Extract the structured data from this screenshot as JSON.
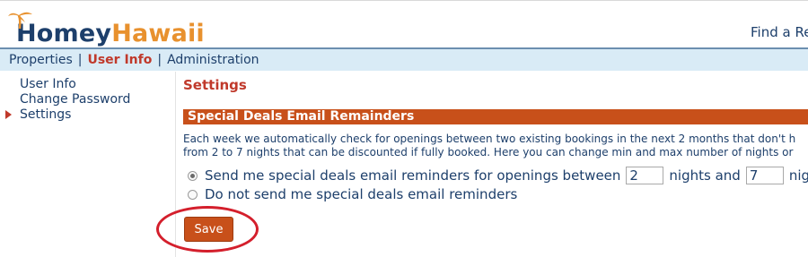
{
  "header": {
    "logo_homey": "Homey",
    "logo_hawaii": "Hawaii",
    "find_link": "Find a Re"
  },
  "nav": {
    "items": [
      {
        "label": "Properties"
      },
      {
        "label": "User Info"
      },
      {
        "label": "Administration"
      }
    ],
    "separator": "|"
  },
  "sidebar": {
    "items": [
      {
        "label": "User Info"
      },
      {
        "label": "Change Password"
      },
      {
        "label": "Settings"
      }
    ]
  },
  "main": {
    "title": "Settings",
    "section_title": "Special Deals Email Remainders",
    "description_line1": "Each week we automatically check for openings between two existing bookings in the next 2 months that don't h",
    "description_line2": "from 2 to 7 nights that can be discounted if fully booked. Here you can change min and max number of nights or",
    "option_send_prefix": "Send me special deals email reminders for openings between",
    "min_nights": "2",
    "option_send_middle": "nights and",
    "max_nights": "7",
    "option_send_suffix": "nights",
    "option_none": "Do not send me special deals email reminders",
    "save_label": "Save"
  },
  "colors": {
    "brand_navy": "#1d3f6b",
    "brand_orange": "#e8912e",
    "section_bar": "#c8501a",
    "annotation_red": "#d41f2c",
    "nav_bg": "#d9ebf6"
  }
}
